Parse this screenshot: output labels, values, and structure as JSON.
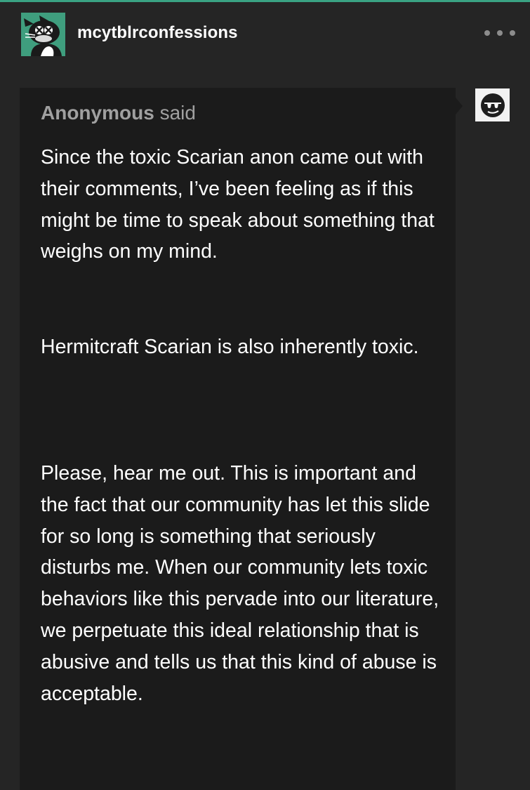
{
  "post": {
    "blog_name": "mcytblrconfessions",
    "more_icon": "ellipsis-icon",
    "blog_avatar_icon": "cartoon-cat-avatar-icon"
  },
  "ask": {
    "asker_name": "Anonymous",
    "asker_action": "said",
    "asker_avatar_icon": "anonymous-sunglasses-avatar-icon",
    "paragraphs": [
      "Since the toxic Scarian anon came out with their comments, I’ve been feeling as if this might be time to speak about something that weighs on my mind.",
      "Hermitcraft Scarian is also inherently toxic.",
      "Please, hear me out. This is important and the fact that our community has let this slide for so long is something that seriously disturbs me. When our community lets toxic behaviors like this pervade into our literature, we perpetuate this ideal relationship that is abusive and tells us that this kind of abuse is acceptable."
    ]
  },
  "colors": {
    "page_background": "#252525",
    "ask_background": "#1b1b1b",
    "accent": "#3aa383",
    "avatar_background": "#3f9e7e",
    "text_primary": "#ffffff",
    "text_muted": "#a0a0a0"
  }
}
